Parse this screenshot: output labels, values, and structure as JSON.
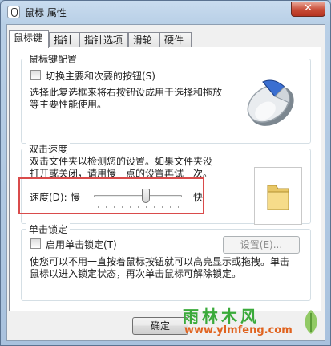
{
  "window": {
    "title": "鼠标 属性",
    "close_glyph": "✕"
  },
  "tabs": [
    {
      "label": "鼠标键",
      "active": true
    },
    {
      "label": "指针",
      "active": false
    },
    {
      "label": "指针选项",
      "active": false
    },
    {
      "label": "滑轮",
      "active": false
    },
    {
      "label": "硬件",
      "active": false
    }
  ],
  "button_config": {
    "title": "鼠标键配置",
    "switch_label": "切换主要和次要的按钮(S)",
    "switch_checked": false,
    "desc_line1": "选择此复选框来将右按钮设成用于选择和拖放",
    "desc_line2": "等主要性能使用。"
  },
  "double_click": {
    "title": "双击速度",
    "desc_line1": "双击文件夹以检测您的设置。如果文件夹没",
    "desc_line2": "打开或关闭，请用慢一点的设置再试一次。",
    "speed_label": "速度(D):",
    "slow_label": "慢",
    "fast_label": "快",
    "speed_value": 0.6,
    "tick_count": 11
  },
  "click_lock": {
    "title": "单击锁定",
    "enable_label": "启用单击锁定(T)",
    "enable_checked": false,
    "settings_label": "设置(E)...",
    "desc_line1": "使您可以不用一直按着鼠标按钮就可以高亮显示或拖拽。单击",
    "desc_line2": "鼠标以进入锁定状态，再次单击鼠标可解除锁定。"
  },
  "footer": {
    "ok_label": "确定"
  },
  "watermark": {
    "title": "雨林木风",
    "url": "www.ylmfeng.com"
  },
  "colors": {
    "highlight": "#d94b4b",
    "accent": "#3b6fd1"
  }
}
